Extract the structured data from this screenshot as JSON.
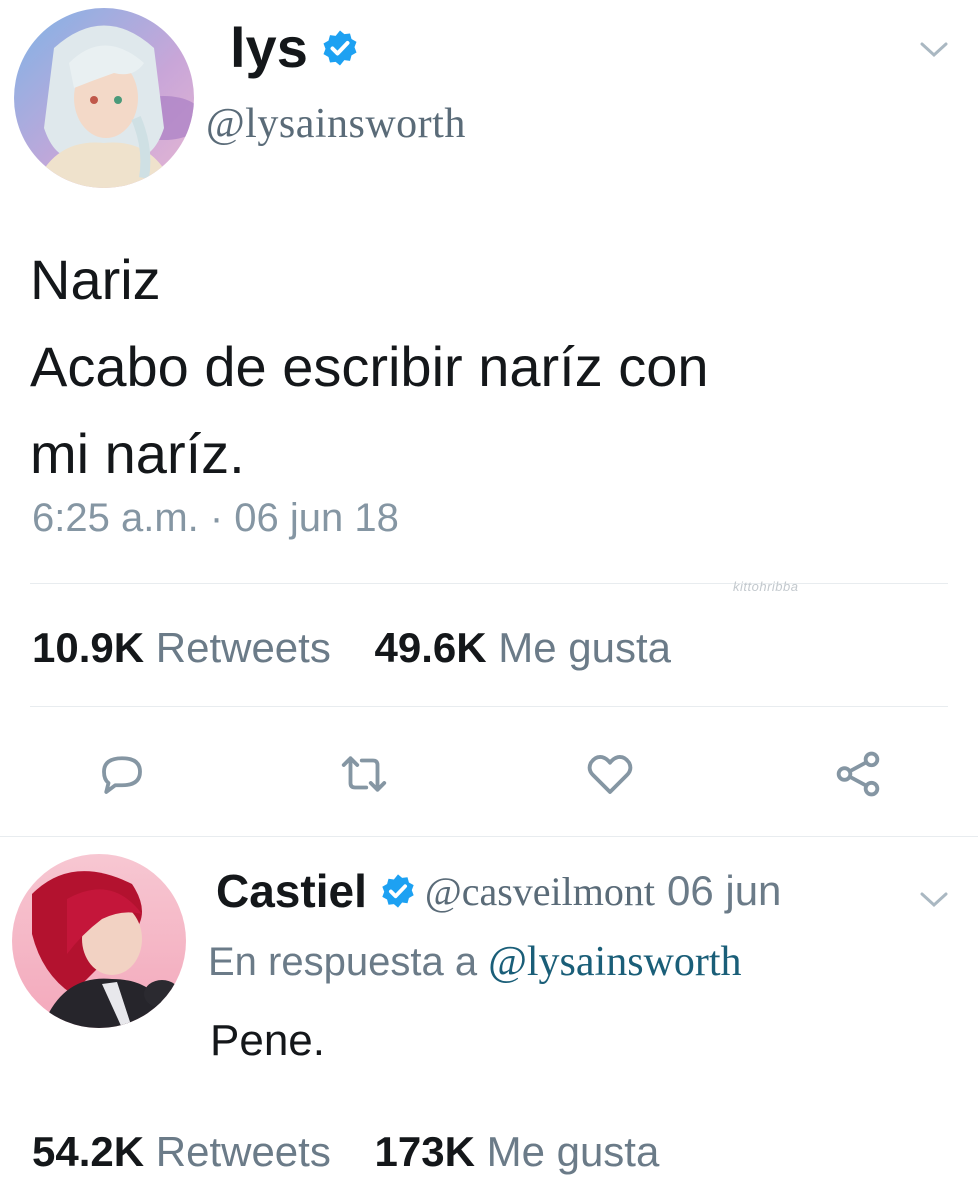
{
  "tweet": {
    "display_name": "lys",
    "handle": "@lysainsworth",
    "verified_icon": "verified-badge-icon",
    "text_lines": [
      "Nariz",
      "Acabo de escribir naríz con",
      "mi naríz."
    ],
    "timestamp": "6:25 a.m. · 06 jun 18",
    "watermark": "kittohribba",
    "retweets": "10.9K",
    "retweets_label": "Retweets",
    "likes": "49.6K",
    "likes_label": "Me gusta",
    "actions": [
      "reply-icon",
      "retweet-icon",
      "like-icon",
      "share-icon"
    ]
  },
  "reply": {
    "display_name": "Castiel",
    "handle": "@casveilmont",
    "date": "06 jun",
    "in_reply_prefix": "En respuesta a",
    "in_reply_handle": "@lysainsworth",
    "text": "Pene.",
    "retweets": "54.2K",
    "retweets_label": "Retweets",
    "likes": "173K",
    "likes_label": "Me gusta"
  },
  "colors": {
    "verified": "#1da1f2",
    "text": "#14171a",
    "muted": "#6b7b88",
    "link": "#1a5e78"
  }
}
